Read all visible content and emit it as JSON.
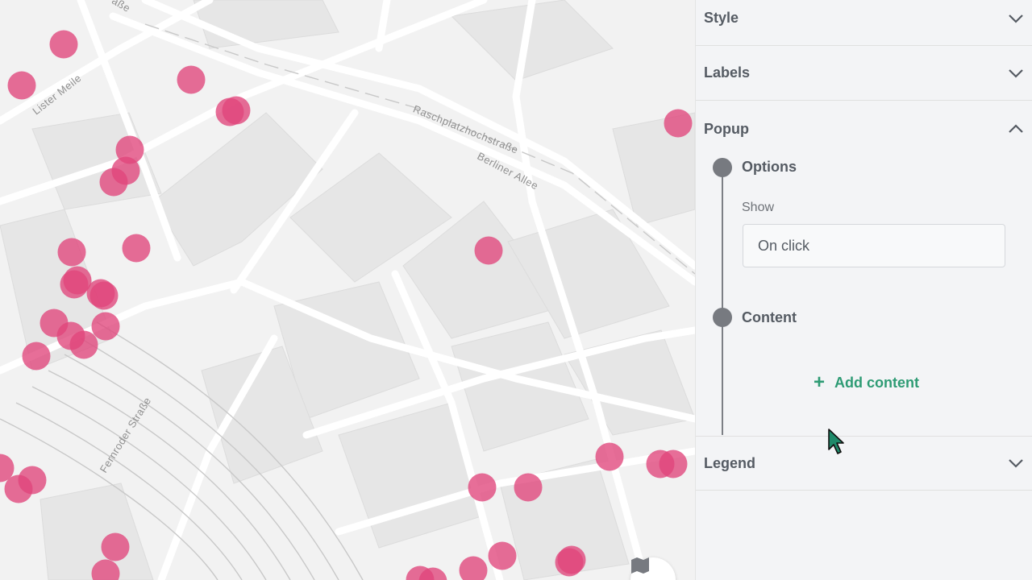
{
  "map": {
    "point_color": "#e0457b",
    "street_labels": {
      "lister_meile": "Lister Meile",
      "raschplatz": "Raschplatzhochstraße",
      "berliner_allee": "Berliner Allee",
      "fernroder": "Fernroder Straße",
      "top_cut": "aße"
    },
    "layers_button_icon": "map-icon"
  },
  "panel": {
    "sections": {
      "style": "Style",
      "labels": "Labels",
      "popup": "Popup",
      "legend": "Legend"
    },
    "popup": {
      "options_label": "Options",
      "show_label": "Show",
      "show_value": "On click",
      "content_label": "Content",
      "add_content_label": "Add content"
    },
    "accent_color": "#2e9b74"
  }
}
